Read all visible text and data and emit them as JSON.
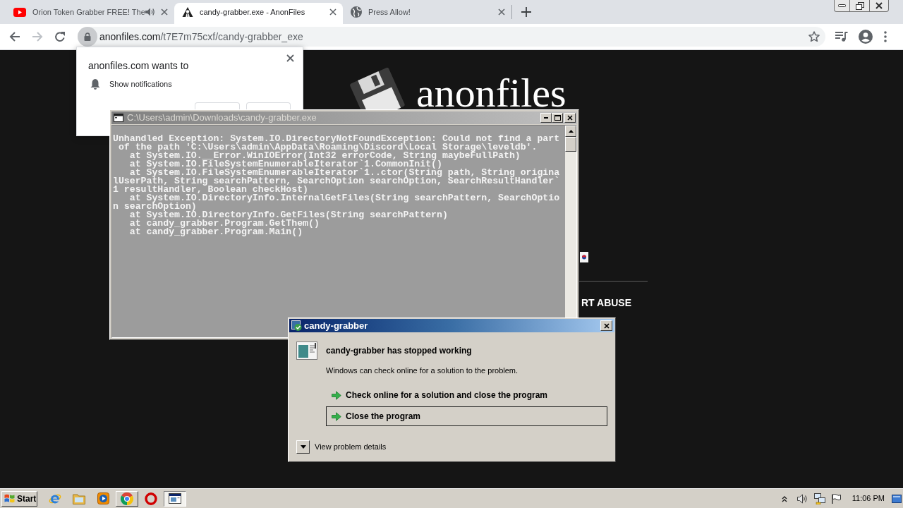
{
  "browser": {
    "tabs": [
      {
        "kind": "video",
        "title": "Orion Token Grabber FREE! The",
        "audio": true,
        "selected": false
      },
      {
        "kind": "site",
        "title": "candy-grabber.exe - AnonFiles",
        "audio": false,
        "selected": true
      },
      {
        "kind": "globe",
        "title": "Press Allow!",
        "audio": false,
        "selected": false
      }
    ],
    "nav": [
      {
        "kind": "back",
        "disabled": false
      },
      {
        "kind": "forward",
        "disabled": true
      },
      {
        "kind": "reload",
        "disabled": false
      }
    ],
    "address": {
      "host": "anonfiles.com",
      "path": "/t7E7m75cxf/candy-grabber_exe"
    }
  },
  "page": {
    "logo": "anonfiles",
    "link": "RT ABUSE"
  },
  "permission_popup": {
    "title": "anonfiles.com wants to",
    "permission": "Show notifications"
  },
  "console": {
    "title": "C:\\Users\\admin\\Downloads\\candy-grabber.exe",
    "lines": [
      "Unhandled Exception: System.IO.DirectoryNotFoundException: Could not find a part",
      " of the path 'C:\\Users\\admin\\AppData\\Roaming\\Discord\\Local Storage\\leveldb'.",
      "   at System.IO.__Error.WinIOError(Int32 errorCode, String maybeFullPath)",
      "   at System.IO.FileSystemEnumerableIterator`1.CommonInit()",
      "   at System.IO.FileSystemEnumerableIterator`1..ctor(String path, String origina",
      "lUserPath, String searchPattern, SearchOption searchOption, SearchResultHandler`",
      "1 resultHandler, Boolean checkHost)",
      "   at System.IO.DirectoryInfo.InternalGetFiles(String searchPattern, SearchOptio",
      "n searchOption)",
      "   at System.IO.DirectoryInfo.GetFiles(String searchPattern)",
      "   at candy_grabber.Program.GetThem()",
      "   at candy_grabber.Program.Main()"
    ]
  },
  "error_dialog": {
    "title": "candy-grabber",
    "heading": "candy-grabber has stopped working",
    "message": "Windows can check online for a solution to the problem.",
    "options": [
      {
        "label": "Check online for a solution and close the program",
        "selected": false
      },
      {
        "label": "Close the program",
        "selected": true
      }
    ],
    "details": "View problem details"
  },
  "taskbar": {
    "start": "Start",
    "items": [
      {
        "kind": "e",
        "task": false,
        "selected": false
      },
      {
        "kind": "folder",
        "task": false,
        "selected": false
      },
      {
        "kind": "media",
        "task": false,
        "selected": false
      },
      {
        "kind": "chrome",
        "task": true,
        "selected": false
      },
      {
        "kind": "ring",
        "task": false,
        "selected": false
      },
      {
        "kind": "console",
        "task": true,
        "selected": true
      }
    ],
    "clock": "11:06 PM"
  }
}
